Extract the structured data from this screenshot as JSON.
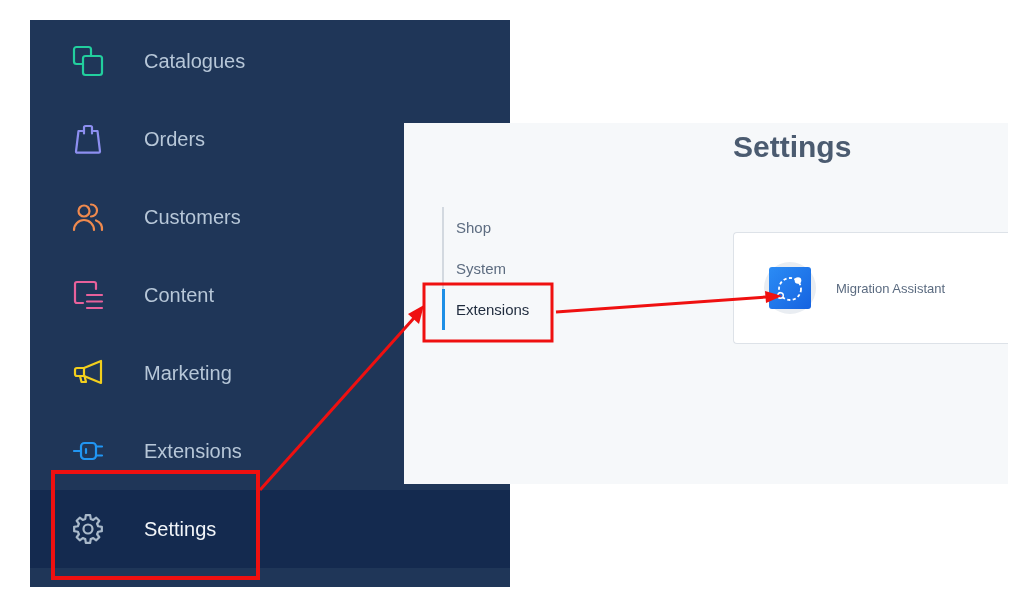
{
  "sidebar": {
    "items": [
      {
        "label": "Catalogues",
        "kind": "squares",
        "color": "#22cf9e",
        "selected": false
      },
      {
        "label": "Orders",
        "kind": "bag",
        "color": "#8d8ff0",
        "selected": false
      },
      {
        "label": "Customers",
        "kind": "people",
        "color": "#f08a4e",
        "selected": false
      },
      {
        "label": "Content",
        "kind": "content",
        "color": "#e8619b",
        "selected": false
      },
      {
        "label": "Marketing",
        "kind": "megaphone",
        "color": "#f2cf1d",
        "selected": false
      },
      {
        "label": "Extensions",
        "kind": "plug",
        "color": "#2196f3",
        "selected": false
      },
      {
        "label": "Settings",
        "kind": "gear",
        "color": "#a9b9ca",
        "selected": true
      }
    ]
  },
  "settings": {
    "title": "Settings",
    "nav": [
      {
        "label": "Shop",
        "selected": false
      },
      {
        "label": "System",
        "selected": false
      },
      {
        "label": "Extensions",
        "selected": true
      }
    ],
    "cards": [
      {
        "label": "Migration Assistant"
      }
    ]
  }
}
